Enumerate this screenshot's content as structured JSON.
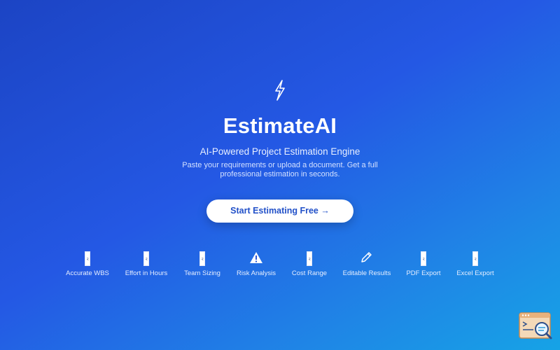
{
  "hero": {
    "logo_icon": "lightning-bolt-icon",
    "title": "EstimateAI",
    "subtitle": "AI-Powered Project Estimation Engine",
    "description": "Paste your requirements or upload a document. Get a full professional estimation in seconds.",
    "cta_label": "Start Estimating Free →"
  },
  "features": [
    {
      "label": "Accurate WBS",
      "icon": "feature-badge-icon"
    },
    {
      "label": "Effort in Hours",
      "icon": "feature-badge-icon"
    },
    {
      "label": "Team Sizing",
      "icon": "feature-badge-icon"
    },
    {
      "label": "Risk Analysis",
      "icon": "warning-icon"
    },
    {
      "label": "Cost Range",
      "icon": "feature-badge-icon"
    },
    {
      "label": "Editable Results",
      "icon": "pencil-icon"
    },
    {
      "label": "PDF Export",
      "icon": "feature-badge-icon"
    },
    {
      "label": "Excel Export",
      "icon": "feature-badge-icon"
    }
  ],
  "corner_widget": {
    "icon": "search-window-icon"
  },
  "colors": {
    "gradient_start": "#1c44c4",
    "gradient_mid": "#2458e4",
    "gradient_end": "#16a3e6",
    "cta_text": "#2150c8",
    "cta_background": "#ffffff"
  }
}
